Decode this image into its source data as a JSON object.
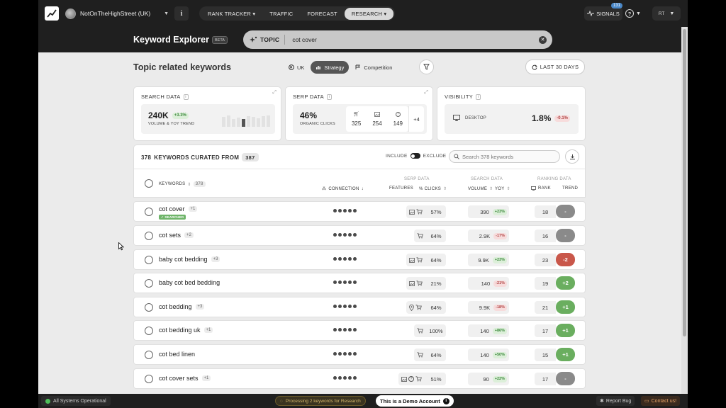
{
  "nav": {
    "site_name": "NotOnTheHighStreet (UK)",
    "tabs": [
      {
        "label": "RANK TRACKER",
        "caret": "▾"
      },
      {
        "label": "TRAFFIC",
        "caret": ""
      },
      {
        "label": "FORECAST",
        "caret": ""
      },
      {
        "label": "RESEARCH",
        "caret": "▾"
      }
    ],
    "signals_label": "SIGNALS",
    "signals_count": "131",
    "user_initials": "RT"
  },
  "header": {
    "title": "Keyword Explorer",
    "beta": "BETA",
    "topic_label": "TOPIC",
    "topic_value": "cot cover"
  },
  "section": {
    "title": "Topic related keywords",
    "segments": [
      "UK",
      "Strategy",
      "Competition"
    ],
    "date_range": "LAST 30 DAYS"
  },
  "cards": {
    "search": {
      "title": "SEARCH DATA",
      "value": "240K",
      "change": "+3.3%",
      "sub": "VOLUME & YOY TREND"
    },
    "serp": {
      "title": "SERP DATA",
      "value": "46%",
      "sub": "ORGANIC CLICKS",
      "feature_counts": [
        "325",
        "254",
        "149"
      ],
      "more": "+4"
    },
    "visibility": {
      "title": "VISIBILITY",
      "device": "DESKTOP",
      "value": "1.8%",
      "change": "-0.1%"
    }
  },
  "list": {
    "curated_prefix": "378",
    "curated_text": "KEYWORDS CURATED FROM",
    "curated_total": "387",
    "include": "INCLUDE",
    "exclude": "EXCLUDE",
    "search_placeholder": "Search 378 keywords",
    "groups": {
      "serp": "SERP DATA",
      "search": "SEARCH DATA",
      "ranking": "RANKING DATA"
    },
    "columns": {
      "keywords": "KEYWORDS",
      "keywords_count": "378",
      "connection": "CONNECTION",
      "features": "FEATURES",
      "clicks": "% CLICKS",
      "volume": "VOLUME",
      "yoy": "YOY",
      "rank": "RANK",
      "trend": "TREND"
    }
  },
  "rows": [
    {
      "keyword": "cot cover",
      "plus": "+1",
      "searched": "✓ SEARCHED",
      "features": [
        "image",
        "cart"
      ],
      "clicks": "57%",
      "volume": "390",
      "yoy": "+23%",
      "yoy_dir": "up",
      "rank": "18",
      "trend": "-",
      "trend_dir": "flat"
    },
    {
      "keyword": "cot sets",
      "plus": "+2",
      "features": [
        "cart"
      ],
      "clicks": "64%",
      "volume": "2.9K",
      "yoy": "-17%",
      "yoy_dir": "down",
      "rank": "16",
      "trend": "-",
      "trend_dir": "flat"
    },
    {
      "keyword": "baby cot bedding",
      "plus": "+3",
      "features": [
        "image",
        "cart"
      ],
      "clicks": "64%",
      "volume": "9.9K",
      "yoy": "+23%",
      "yoy_dir": "up",
      "rank": "23",
      "trend": "-2",
      "trend_dir": "down"
    },
    {
      "keyword": "baby cot bed bedding",
      "plus": "",
      "features": [
        "image",
        "cart"
      ],
      "clicks": "21%",
      "volume": "140",
      "yoy": "-21%",
      "yoy_dir": "down",
      "rank": "19",
      "trend": "+2",
      "trend_dir": "up"
    },
    {
      "keyword": "cot bedding",
      "plus": "+3",
      "features": [
        "pin",
        "cart"
      ],
      "clicks": "64%",
      "volume": "9.9K",
      "yoy": "-18%",
      "yoy_dir": "down",
      "rank": "21",
      "trend": "+1",
      "trend_dir": "up"
    },
    {
      "keyword": "cot bedding uk",
      "plus": "+1",
      "features": [
        "cart"
      ],
      "clicks": "100%",
      "volume": "140",
      "yoy": "+86%",
      "yoy_dir": "up",
      "rank": "17",
      "trend": "+1",
      "trend_dir": "up"
    },
    {
      "keyword": "cot bed linen",
      "plus": "",
      "features": [
        "cart"
      ],
      "clicks": "64%",
      "volume": "140",
      "yoy": "+50%",
      "yoy_dir": "up",
      "rank": "15",
      "trend": "+1",
      "trend_dir": "up"
    },
    {
      "keyword": "cot cover sets",
      "plus": "+1",
      "features": [
        "image",
        "question",
        "cart"
      ],
      "clicks": "51%",
      "volume": "90",
      "yoy": "+22%",
      "yoy_dir": "up",
      "rank": "17",
      "trend": "-",
      "trend_dir": "flat"
    }
  ],
  "footer": {
    "status": "All Systems Operational",
    "processing": "Processing 2 keywords for Research",
    "demo": "This is a Demo Account",
    "report_bug": "Report Bug",
    "contact": "Contact us!"
  }
}
